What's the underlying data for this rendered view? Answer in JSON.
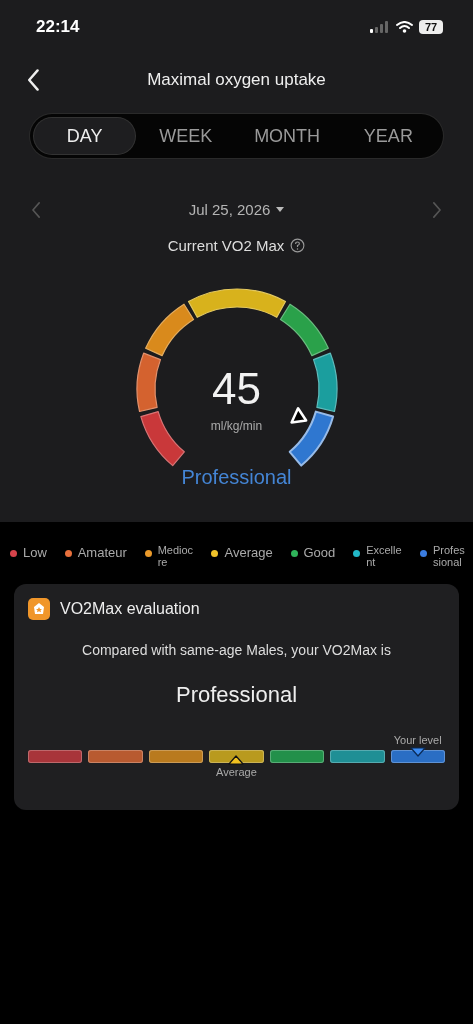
{
  "status_bar": {
    "time": "22:14",
    "battery": "77"
  },
  "header": {
    "title": "Maximal oxygen uptake"
  },
  "tabs": [
    {
      "label": "DAY",
      "selected": true
    },
    {
      "label": "WEEK",
      "selected": false
    },
    {
      "label": "MONTH",
      "selected": false
    },
    {
      "label": "YEAR",
      "selected": false
    }
  ],
  "date": {
    "label": "Jul 25, 2026"
  },
  "current": {
    "label": "Current VO2 Max",
    "value": "45",
    "unit": "ml/kg/min",
    "rating": "Professional"
  },
  "gauge": [
    {
      "color": "#c9383a",
      "selected": false
    },
    {
      "color": "#d4622f",
      "selected": false
    },
    {
      "color": "#d98a1c",
      "selected": false
    },
    {
      "color": "#d8b21c",
      "selected": false
    },
    {
      "color": "#2aa14a",
      "selected": false
    },
    {
      "color": "#1b9e9e",
      "selected": false
    },
    {
      "color": "#2f77d0",
      "selected": true
    }
  ],
  "legend": [
    {
      "label": "Low",
      "color": "#d6434b"
    },
    {
      "label": "Amateur",
      "color": "#e8703c"
    },
    {
      "label": "Mediocre",
      "color": "#eb9a2a"
    },
    {
      "label": "Average",
      "color": "#f0c22a"
    },
    {
      "label": "Good",
      "color": "#2fb35a"
    },
    {
      "label": "Excellent",
      "color": "#22b8c8"
    },
    {
      "label": "Professional",
      "color": "#3b7de0"
    }
  ],
  "evaluation": {
    "title": "VO2Max evaluation",
    "comparison": "Compared with same-age Males, your VO2Max is",
    "result": "Professional",
    "scale": [
      {
        "color": "#a8353a"
      },
      {
        "color": "#b85a30"
      },
      {
        "color": "#b97a1e"
      },
      {
        "color": "#b99a1e",
        "marker": {
          "kind": "average",
          "label": "Average"
        }
      },
      {
        "color": "#22904a"
      },
      {
        "color": "#1f8f95"
      },
      {
        "color": "#2a6ec4",
        "marker": {
          "kind": "yours",
          "label": "Your level"
        }
      }
    ]
  }
}
